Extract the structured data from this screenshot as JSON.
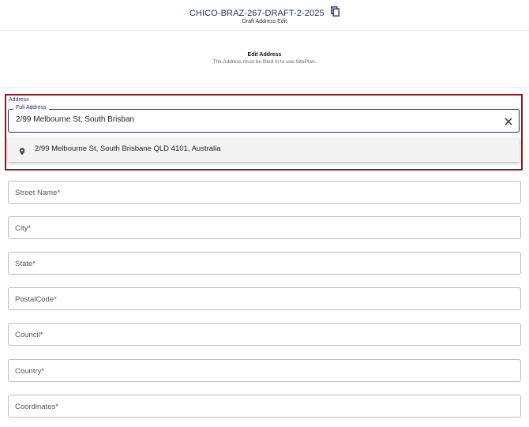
{
  "header": {
    "project_id": "CHICO-BRAZ-267-DRAFT-2-2025",
    "subtitle": "Draft Address Edit",
    "copy_icon": "copy-icon"
  },
  "edit_section": {
    "title": "Edit Address",
    "description": "The Address must be filled in to use SitePlan."
  },
  "address": {
    "section_label": "Address",
    "full_address_label": "Full Address",
    "full_address_value": "2/99 Melbourne St, South Brisban",
    "clear_icon": "close-icon",
    "suggestion_icon": "location-pin-icon",
    "suggestion": "2/99 Melbourne St, South Brisbane QLD 4101, Australia"
  },
  "fields": {
    "street_name": "Street Name*",
    "city": "City*",
    "state": "State*",
    "postal_code": "PostalCode*",
    "council": "Council*",
    "country": "Country*",
    "coordinates": "Coordinates*"
  },
  "colors": {
    "accent": "#1f2f6b",
    "highlight_border": "#8b1a1a"
  }
}
